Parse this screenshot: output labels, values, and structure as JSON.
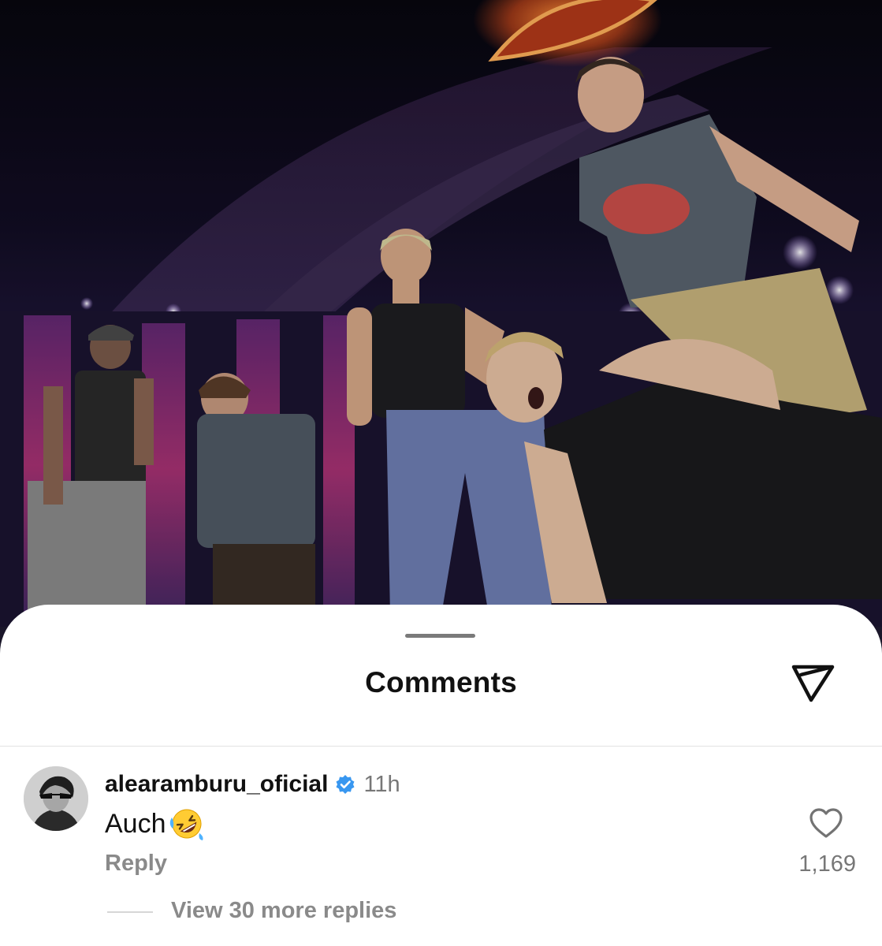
{
  "photo": {
    "description_icon": "concert-stage-photo"
  },
  "sheet": {
    "title": "Comments",
    "share_icon": "send-icon"
  },
  "comment": {
    "username": "alearamburu_oficial",
    "verified_icon": "verified-badge-icon",
    "timestamp": "11h",
    "text": "Auch",
    "emoji_icon": "rolling-on-floor-laughing-emoji",
    "reply_label": "Reply",
    "like_icon": "heart-icon",
    "like_count": "1,169",
    "view_replies_label": "View 30 more replies"
  },
  "colors": {
    "verified": "#3897f0",
    "secondary_text": "#8a8a8a",
    "primary_text": "#111111"
  }
}
